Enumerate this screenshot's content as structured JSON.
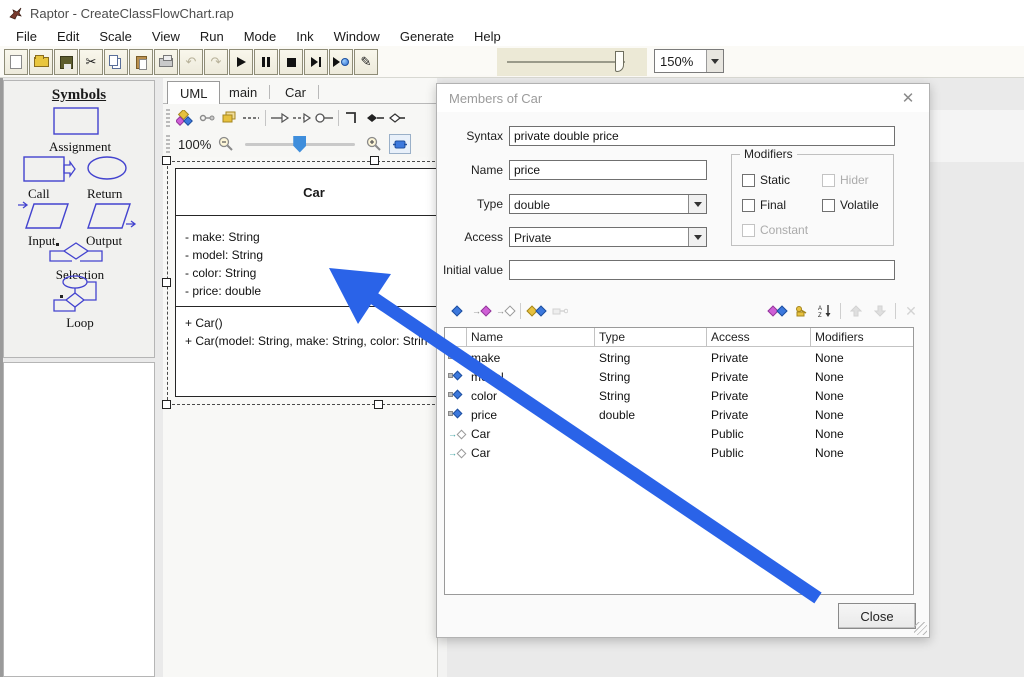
{
  "titlebar": {
    "title": "Raptor - CreateClassFlowChart.rap"
  },
  "menubar": {
    "items": [
      "File",
      "Edit",
      "Scale",
      "View",
      "Run",
      "Mode",
      "Ink",
      "Window",
      "Generate",
      "Help"
    ]
  },
  "toolbar": {
    "zoom_select": "150%"
  },
  "symbols": {
    "title": "Symbols",
    "labels": [
      "Assignment",
      "Call",
      "Return",
      "Input",
      "Output",
      "Selection",
      "Loop"
    ]
  },
  "tabs": {
    "items": [
      "UML",
      "main",
      "Car"
    ]
  },
  "uml_toolbar": {
    "zoom_level": "100%"
  },
  "diagram": {
    "class_name": "Car",
    "attributes": [
      "- make: String",
      "- model: String",
      "- color: String",
      "- price: double"
    ],
    "methods": [
      "+ Car()",
      "+ Car(model: String, make: String, color: Strin"
    ]
  },
  "dialog": {
    "title": "Members of Car",
    "syntax": {
      "label": "Syntax",
      "value": "private double price"
    },
    "name": {
      "label": "Name",
      "value": "price"
    },
    "type": {
      "label": "Type",
      "value": "double"
    },
    "access": {
      "label": "Access",
      "value": "Private"
    },
    "initial": {
      "label": "Initial value",
      "value": ""
    },
    "modifiers": {
      "title": "Modifiers",
      "static": "Static",
      "hider": "Hider",
      "final": "Final",
      "volatile": "Volatile",
      "constant": "Constant"
    },
    "table": {
      "columns": [
        "Name",
        "Type",
        "Access",
        "Modifiers"
      ],
      "rows": [
        {
          "kind": "field",
          "name": "make",
          "type": "String",
          "access": "Private",
          "modifiers": "None"
        },
        {
          "kind": "field",
          "name": "model",
          "type": "String",
          "access": "Private",
          "modifiers": "None"
        },
        {
          "kind": "field",
          "name": "color",
          "type": "String",
          "access": "Private",
          "modifiers": "None"
        },
        {
          "kind": "field",
          "name": "price",
          "type": "double",
          "access": "Private",
          "modifiers": "None"
        },
        {
          "kind": "constructor",
          "name": "Car",
          "type": "",
          "access": "Public",
          "modifiers": "None"
        },
        {
          "kind": "constructor",
          "name": "Car",
          "type": "",
          "access": "Public",
          "modifiers": "None"
        }
      ]
    },
    "close_label": "Close"
  },
  "colors": {
    "annotation_arrow": "#2a63e8",
    "symbol_outline": "#4343cf",
    "slider_thumb": "#3f8edc"
  }
}
